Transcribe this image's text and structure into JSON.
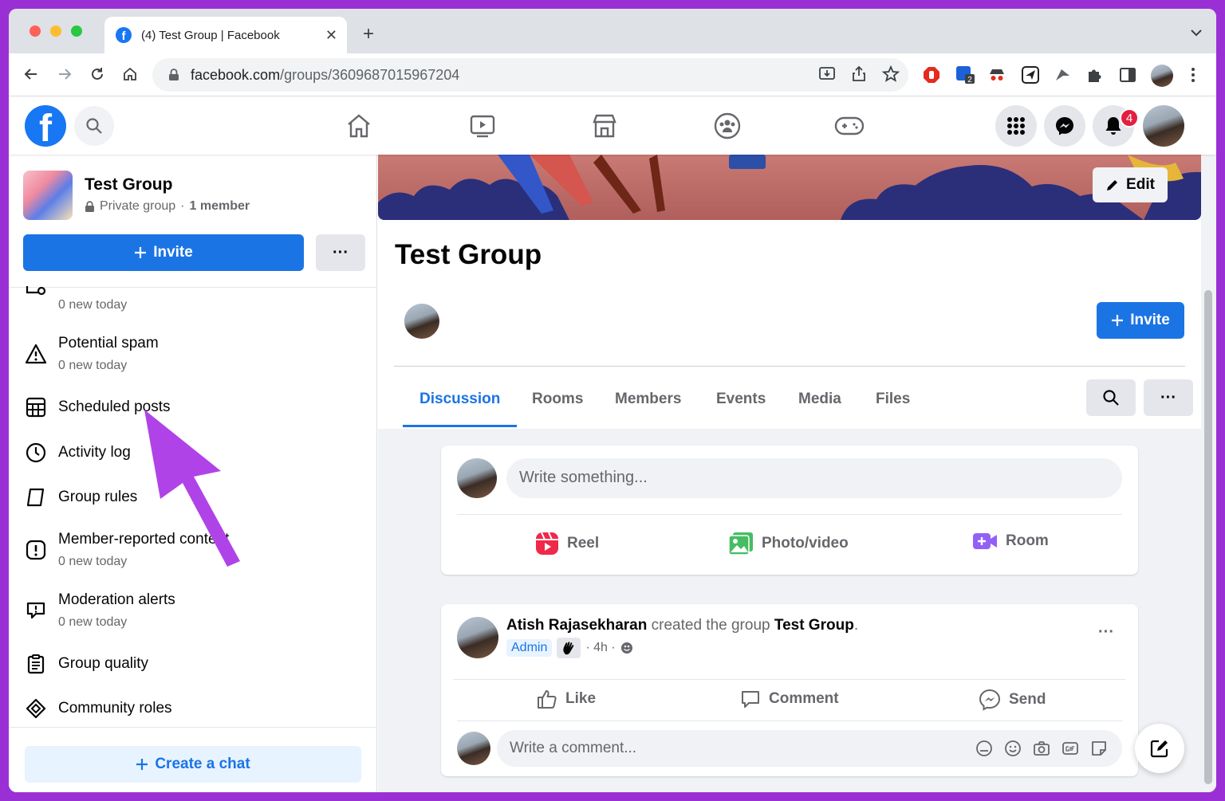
{
  "browser": {
    "tab_title": "(4) Test Group | Facebook",
    "url_host": "facebook.com",
    "url_path": "/groups/3609687015967204",
    "extension_badge": "2"
  },
  "header": {
    "logo_text": "f",
    "notification_count": "4"
  },
  "sidebar": {
    "group_name": "Test Group",
    "privacy": "Private group",
    "separator": "·",
    "member_count": "1 member",
    "invite_label": "Invite",
    "more_label": "···",
    "items": [
      {
        "label": "",
        "sub": "0 new today",
        "icon": "queue-icon"
      },
      {
        "label": "Potential spam",
        "sub": "0 new today",
        "icon": "warning-icon"
      },
      {
        "label": "Scheduled posts",
        "sub": "",
        "icon": "calendar-icon"
      },
      {
        "label": "Activity log",
        "sub": "",
        "icon": "clock-icon"
      },
      {
        "label": "Group rules",
        "sub": "",
        "icon": "book-icon"
      },
      {
        "label": "Member-reported content",
        "sub": "0 new today",
        "icon": "alert-icon"
      },
      {
        "label": "Moderation alerts",
        "sub": "0 new today",
        "icon": "speech-alert-icon"
      },
      {
        "label": "Group quality",
        "sub": "",
        "icon": "clipboard-icon"
      },
      {
        "label": "Community roles",
        "sub": "",
        "icon": "diamond-icon"
      }
    ],
    "create_chat_label": "Create a chat"
  },
  "main": {
    "edit_label": "Edit",
    "title": "Test Group",
    "invite_label": "Invite",
    "tabs": [
      "Discussion",
      "Rooms",
      "Members",
      "Events",
      "Media",
      "Files"
    ],
    "composer": {
      "placeholder": "Write something...",
      "actions": [
        "Reel",
        "Photo/video",
        "Room"
      ]
    },
    "post": {
      "author": "Atish Rajasekharan",
      "action_text": "created the group",
      "group": "Test Group",
      "period": ".",
      "badge": "Admin",
      "time": "· 4h ·",
      "actions": [
        "Like",
        "Comment",
        "Send"
      ],
      "comment_placeholder": "Write a comment...",
      "more_label": "···"
    }
  },
  "colors": {
    "accent": "#1b74e4",
    "background": "#9b2fd6",
    "arrow": "#b043e8"
  }
}
